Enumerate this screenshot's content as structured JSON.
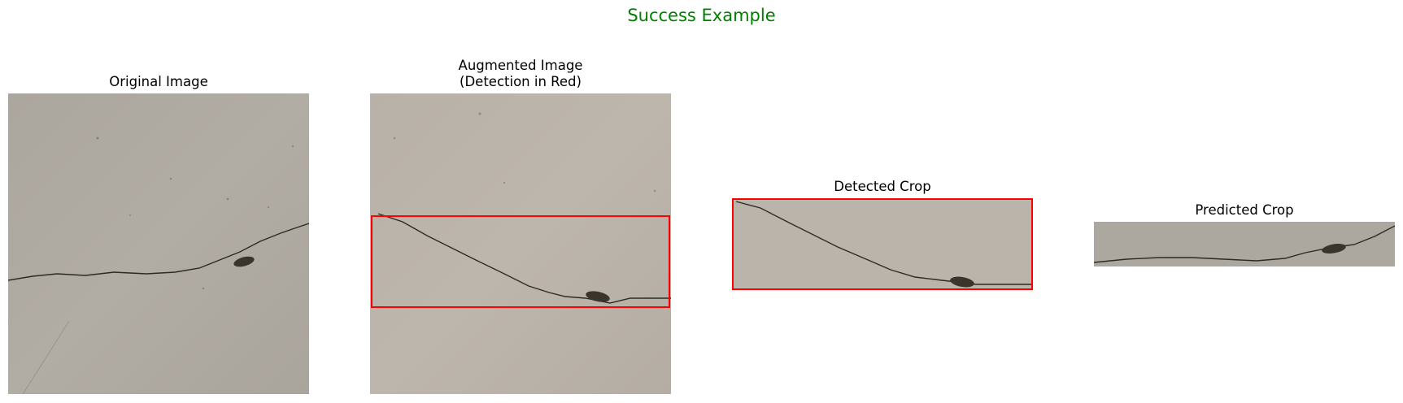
{
  "figure": {
    "title": "Success Example",
    "title_color": "#008000"
  },
  "panels": [
    {
      "title": "Original Image"
    },
    {
      "title": "Augmented Image\n(Detection in Red)"
    },
    {
      "title": "Detected Crop"
    },
    {
      "title": "Predicted Crop"
    }
  ],
  "detection_color": "#ff0000",
  "surface_color": "#b3aca2"
}
